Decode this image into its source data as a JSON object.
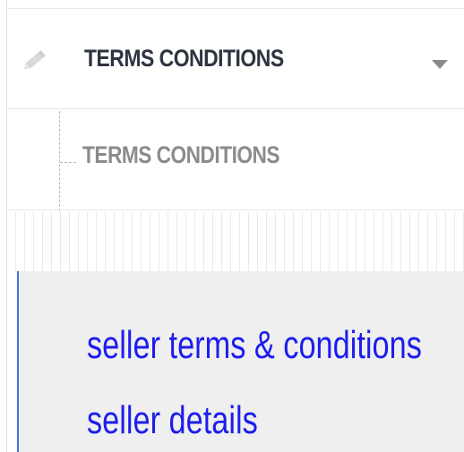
{
  "menu": {
    "header_label": "TERMS CONDITIONS",
    "header_icon": "pencil-icon",
    "toggle_icon": "caret-down-icon",
    "submenu_items": [
      {
        "label": "TERMS CONDITIONS"
      }
    ]
  },
  "links": [
    {
      "label": "seller terms & conditions"
    },
    {
      "label": "seller details"
    }
  ],
  "colors": {
    "header_text": "#2e3440",
    "submenu_text": "#8b8b8b",
    "link_text": "#1d1dee",
    "links_background": "#efefef",
    "accent_border": "#3a74d6"
  }
}
